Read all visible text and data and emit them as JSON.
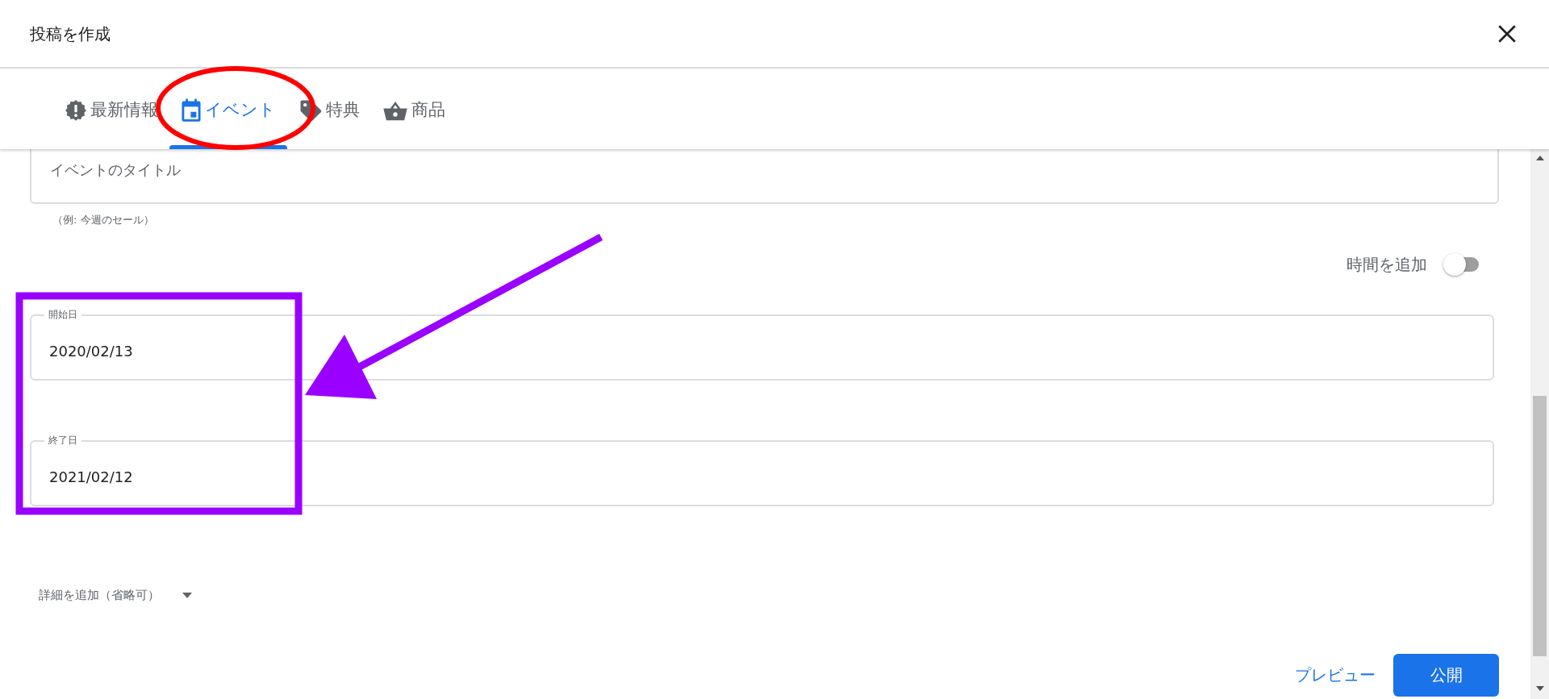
{
  "dialog": {
    "title": "投稿を作成"
  },
  "tabs": [
    {
      "label": "最新情報",
      "kind": "news",
      "selected": false
    },
    {
      "label": "イベント",
      "kind": "event",
      "selected": true
    },
    {
      "label": "特典",
      "kind": "offer",
      "selected": false
    },
    {
      "label": "商品",
      "kind": "product",
      "selected": false
    }
  ],
  "title_field": {
    "placeholder": "イベントのタイトル",
    "hint": "（例: 今週のセール）"
  },
  "time_toggle": {
    "label": "時間を追加",
    "on": false
  },
  "date_fields": [
    {
      "label": "開始日",
      "value": "2020/02/13"
    },
    {
      "label": "終了日",
      "value": "2021/02/12"
    }
  ],
  "details": {
    "label": "詳細を追加（省略可）",
    "expanded": false
  },
  "actions": {
    "preview": "プレビュー",
    "publish": "公開"
  }
}
